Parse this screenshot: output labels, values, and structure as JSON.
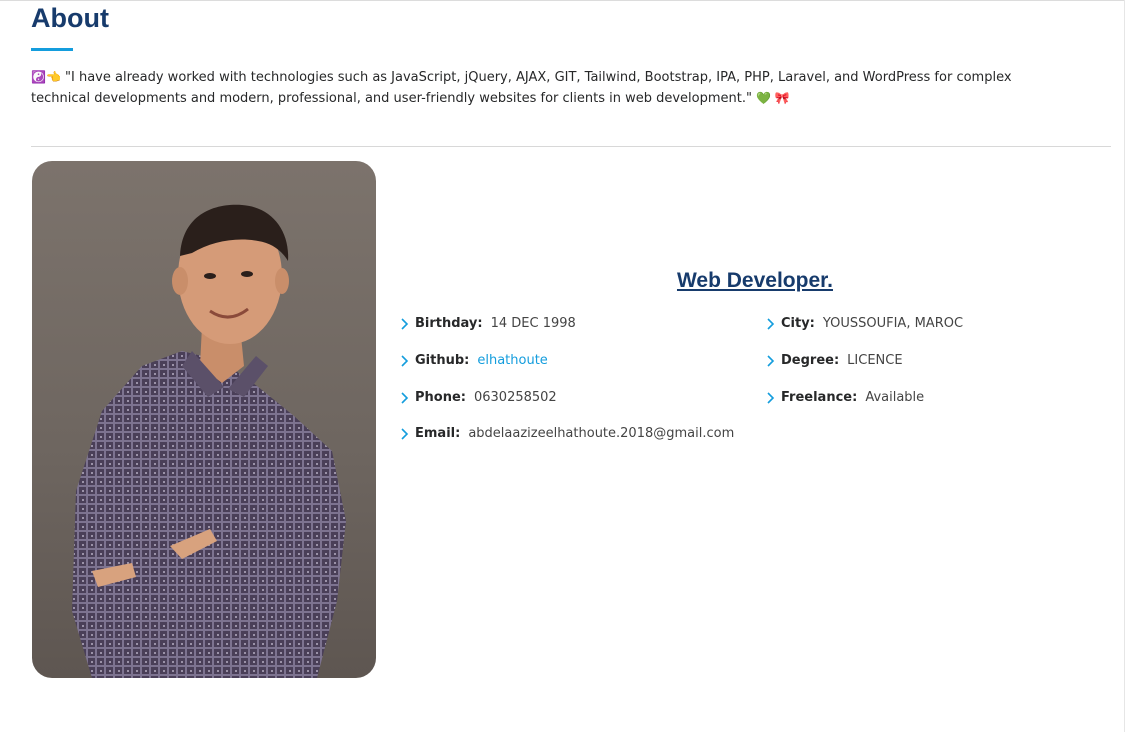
{
  "about": {
    "title": "About",
    "intro_emoji_prefix": "☯️👈",
    "intro_text": "\"I have already worked with technologies such as JavaScript, jQuery, AJAX, GIT, Tailwind, Bootstrap, IPA, PHP, Laravel, and WordPress for complex technical developments and modern, professional, and user-friendly websites for clients in web development.\"",
    "intro_emoji_suffix": "💚 🎀"
  },
  "profile": {
    "role": "Web Developer.",
    "left": [
      {
        "label": "Birthday:",
        "value": "14 DEC 1998"
      },
      {
        "label": "Github:",
        "value": "elhathoute"
      },
      {
        "label": "Phone:",
        "value": "0630258502"
      },
      {
        "label": "Email:",
        "value": "abdelaazizeelhathoute.2018@gmail.com"
      }
    ],
    "right": [
      {
        "label": "City:",
        "value": "YOUSSOUFIA, MAROC"
      },
      {
        "label": "Degree:",
        "value": "LICENCE"
      },
      {
        "label": "Freelance:",
        "value": "Available"
      }
    ]
  },
  "colors": {
    "heading": "#173b6c",
    "accent": "#149ddd",
    "text": "#272829"
  },
  "icons": {
    "info_bullet": "chevron-right-icon"
  }
}
